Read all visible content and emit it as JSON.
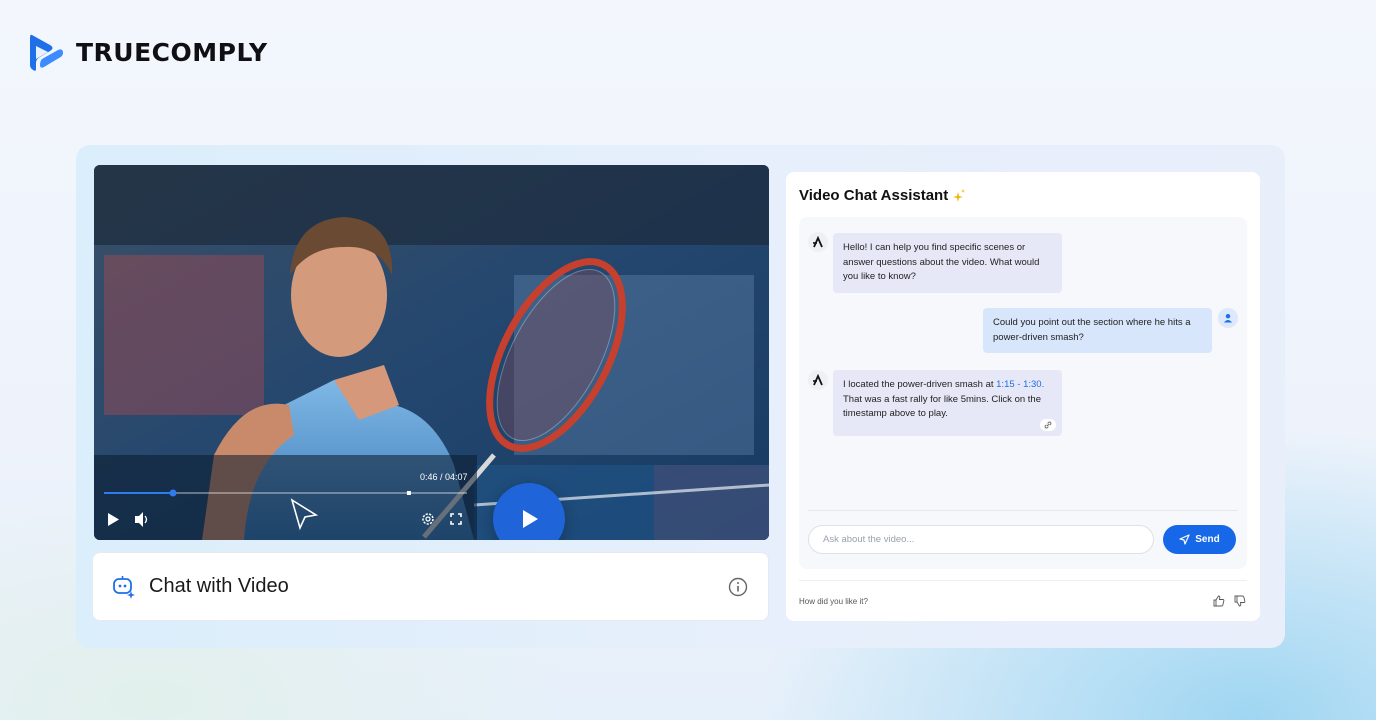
{
  "brand": {
    "name": "TRUECOMPLY",
    "color": "#1f6fe8"
  },
  "video": {
    "current_time": "0:46",
    "duration": "04:07",
    "time_display": "0:46 / 04:07",
    "progress_fraction": 0.19,
    "buffered_fraction": 0.84,
    "play_icon": "play-icon",
    "volume_icon": "volume-icon",
    "settings_icon": "gear-icon",
    "fullscreen_icon": "fullscreen-icon"
  },
  "chat_video": {
    "title": "Chat with Video",
    "icon": "chat-bot-icon",
    "info_icon": "info-icon"
  },
  "assistant": {
    "title": "Video Chat Assistant",
    "sparkle_icon": "sparkle-icon",
    "messages": [
      {
        "from": "bot",
        "text": "Hello! I can help you find specific scenes or answer questions about the video. What would you like to know?"
      },
      {
        "from": "user",
        "text": "Could you point out the section where he hits a power-driven smash?"
      },
      {
        "from": "bot",
        "text_before": "I located the power-driven smash at ",
        "timestamp": "1:15 - 1:30.",
        "text_after": " That was a fast rally for like 5mins. Click on the timestamp above to play."
      }
    ],
    "input": {
      "placeholder": "Ask about the video...",
      "value": ""
    },
    "send_label": "Send",
    "feedback_label": "How did you like it?"
  },
  "colors": {
    "accent": "#1668e8",
    "bot_bubble": "#e6e8f7",
    "user_bubble": "#d7e6fb",
    "timestamp_link": "#1e6fe0",
    "sparkle": "#f5b400"
  }
}
